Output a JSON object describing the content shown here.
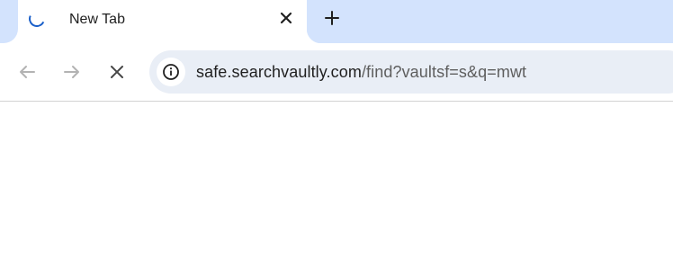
{
  "tabs": [
    {
      "title": "New Tab",
      "loading": true,
      "favicon": "loading-spinner-icon"
    }
  ],
  "tabstrip": {
    "new_tab_icon": "plus-icon",
    "close_icon": "close-icon"
  },
  "toolbar": {
    "back_icon": "arrow-left-icon",
    "forward_icon": "arrow-right-icon",
    "stop_icon": "close-icon",
    "site_info_icon": "info-icon"
  },
  "omnibox": {
    "url_host": "safe.searchvaultly.com",
    "url_path": "/find?vaultsf=s&q=mwt"
  },
  "colors": {
    "tabstrip_bg": "#d3e3fd",
    "omnibox_bg": "#e9eef6",
    "spinner": "#1a5fc9",
    "text": "#1f1f1f",
    "text_muted": "#5e5e5e",
    "icon_disabled": "#b3b3b3"
  }
}
